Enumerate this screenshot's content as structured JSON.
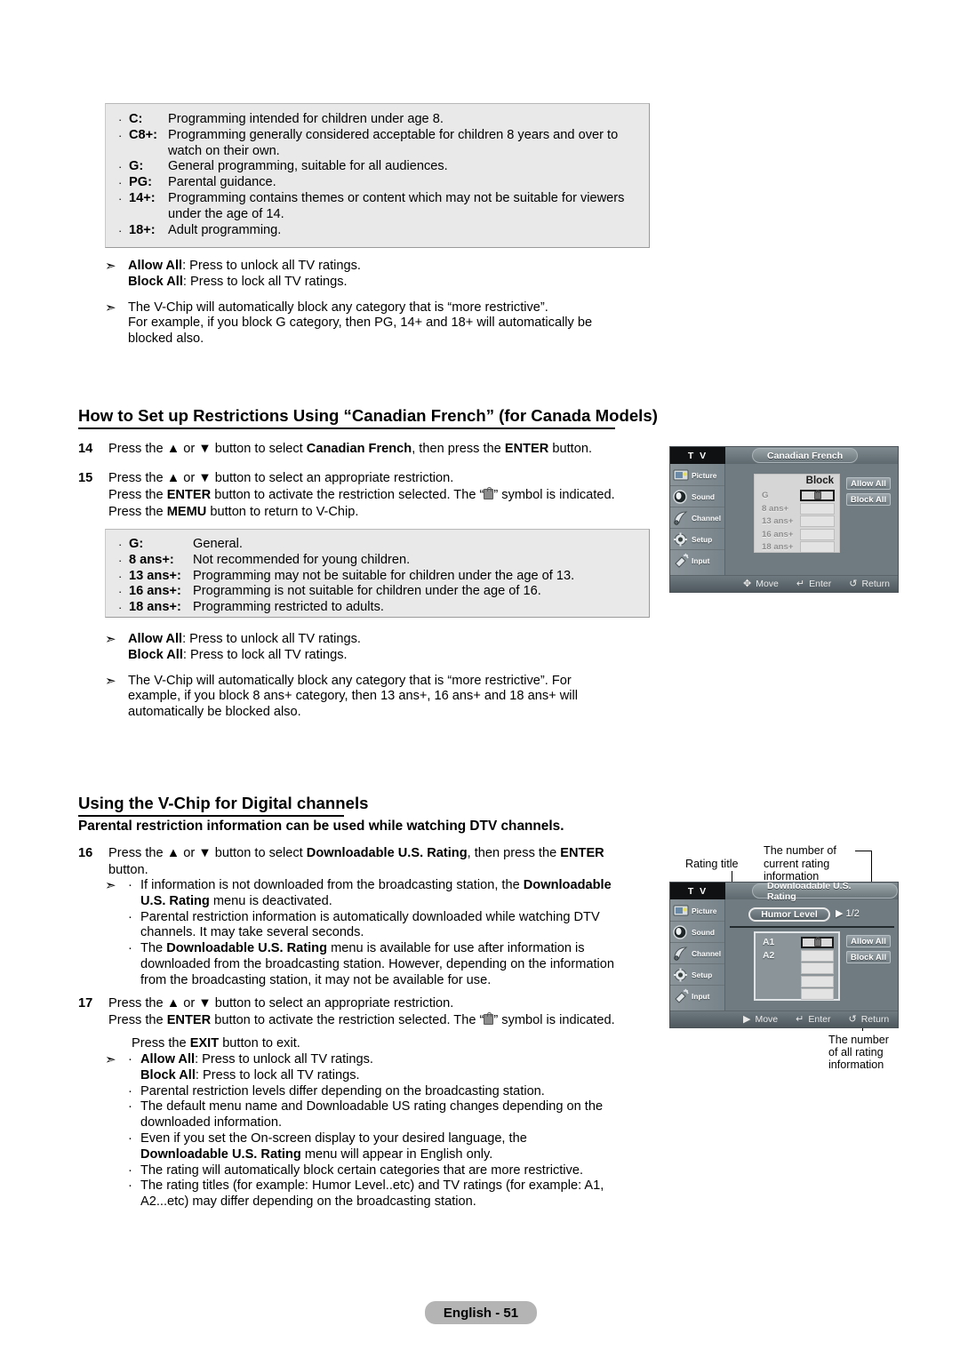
{
  "page": {
    "footer_label": "English - 51"
  },
  "tv_ratings_box": {
    "items": [
      {
        "key": "C:",
        "desc": "Programming intended for children under age 8.",
        "cont": ""
      },
      {
        "key": "C8+:",
        "desc": "Programming generally considered acceptable for children 8 years and over to",
        "cont": "watch on their own."
      },
      {
        "key": "G:",
        "desc": "General programming, suitable for all audiences.",
        "cont": ""
      },
      {
        "key": "PG:",
        "desc": "Parental guidance.",
        "cont": ""
      },
      {
        "key": "14+:",
        "desc": "Programming contains themes or content which may not be suitable for viewers",
        "cont": "under the age of 14."
      },
      {
        "key": "18+:",
        "desc": "Adult programming.",
        "cont": ""
      }
    ]
  },
  "notes_english": {
    "arrow": "➣",
    "n1_bold1": "Allow All",
    "n1_rest1": ": Press to unlock all TV ratings.",
    "n1_bold2": "Block All",
    "n1_rest2": ": Press to lock all TV ratings.",
    "n2_l1": "The V-Chip will automatically block any category that is “more restrictive”.",
    "n2_l2": "For example, if you block G category, then PG, 14+ and 18+ will automatically be",
    "n2_l3": "blocked also."
  },
  "section_cf": {
    "heading": "How to Set up Restrictions Using “Canadian French” (for Canada Models)",
    "step14": {
      "num": "14",
      "pre": "Press the ",
      "up": "▲",
      "mid": " or ",
      "down": "▼",
      "post": " button to select ",
      "bold1": "Canadian French",
      "post2": ", then press the ",
      "bold2": "ENTER",
      "post3": " button."
    },
    "step15": {
      "num": "15",
      "l1_pre": "Press the ",
      "l1_up": "▲",
      "l1_mid": " or ",
      "l1_down": "▼",
      "l1_post": " button to select an appropriate restriction.",
      "l2_pre": "Press the ",
      "l2_b": "ENTER",
      "l2_mid": " button to activate the restriction selected. The “",
      "l2_post": "” symbol is indicated.",
      "l3_pre": "Press the ",
      "l3_b": "MEMU",
      "l3_post": " button to return to V-Chip."
    }
  },
  "cf_ratings_box": {
    "items": [
      {
        "key": "G:",
        "desc": "General."
      },
      {
        "key": "8 ans+:",
        "desc": "Not recommended for young children."
      },
      {
        "key": "13 ans+:",
        "desc": "Programming may not be suitable for children under the age of 13."
      },
      {
        "key": "16 ans+:",
        "desc": "Programming is not suitable for children under the age of 16."
      },
      {
        "key": "18 ans+:",
        "desc": "Programming restricted to adults."
      }
    ]
  },
  "notes_cf": {
    "arrow": "➣",
    "n1_bold1": "Allow All",
    "n1_rest1": ": Press to unlock all TV ratings.",
    "n1_bold2": "Block All",
    "n1_rest2": ": Press to lock all TV ratings.",
    "n2_l1": "The V-Chip will automatically block any category that is “more restrictive”. For",
    "n2_l2": "example, if you block 8 ans+ category, then 13 ans+, 16 ans+ and 18 ans+ will",
    "n2_l3": "automatically be blocked also."
  },
  "section_dtv": {
    "heading": "Using the V-Chip for Digital channels",
    "subheading": "Parental restriction information can be used while watching DTV channels.",
    "step16": {
      "num": "16",
      "pre": "Press the ",
      "up": "▲",
      "mid": " or ",
      "down": "▼",
      "post": " button to select ",
      "bold1": "Downloadable U.S. Rating",
      "post2": ", then press the ",
      "bold2": "ENTER",
      "l2": "button."
    },
    "step16_notes": [
      {
        "bullet": "·",
        "lines": [
          {
            "t": "If information is not downloaded from the broadcasting station, the ",
            "b": "Downloadable"
          },
          {
            "b": "U.S. Rating",
            "t": " menu is deactivated."
          }
        ]
      },
      {
        "bullet": "·",
        "lines": [
          {
            "t": "Parental restriction information is automatically downloaded while watching DTV"
          },
          {
            "t": "channels. It may take several seconds."
          }
        ]
      },
      {
        "bullet": "·",
        "lines": [
          {
            "t": "The ",
            "b": "Downloadable U.S. Rating",
            "t2": " menu is available for use after information is"
          },
          {
            "t": "downloaded from the broadcasting station. However, depending on the information"
          },
          {
            "t": "from the broadcasting station, it may not be available for use."
          }
        ]
      }
    ],
    "step17": {
      "num": "17",
      "l1_pre": "Press the ",
      "l1_up": "▲",
      "l1_mid": " or ",
      "l1_down": "▼",
      "l1_post": " button to select an appropriate restriction.",
      "l2_pre": "Press the ",
      "l2_b": "ENTER",
      "l2_mid": " button to activate the restriction selected. The “",
      "l2_post": "” symbol is indicated.",
      "l3_pre": "Press the ",
      "l3_b": "EXIT",
      "l3_post": " button to exit."
    },
    "step17_notes": {
      "arrow": "➣",
      "bullet": "·",
      "b1_bold": "Allow All",
      "b1_rest": ": Press to unlock all TV ratings.",
      "b1_bold2": "Block All",
      "b1_rest2": ": Press to lock all TV ratings.",
      "b2": "Parental restriction levels differ depending on the broadcasting station.",
      "b3_l1": "The default menu name and Downloadable US rating changes depending on the",
      "b3_l2": "downloaded information.",
      "b4_l1": "Even if you set the On-screen display to your desired language, the",
      "b4_l2_bold": "Downloadable U.S. Rating",
      "b4_l2_rest": " menu will appear in English only.",
      "b5": "The rating will automatically block certain categories that are more restrictive.",
      "b6_l1": "The rating titles (for example: Humor Level..etc) and TV ratings (for example: A1,",
      "b6_l2": "A2...etc) may differ depending on the broadcasting station."
    }
  },
  "tv_menu_cf": {
    "tv_label": "T V",
    "title": "Canadian French",
    "sidebar": [
      {
        "label": "Picture",
        "icon": "picture-icon"
      },
      {
        "label": "Sound",
        "icon": "sound-icon"
      },
      {
        "label": "Channel",
        "icon": "channel-icon"
      },
      {
        "label": "Setup",
        "icon": "setup-icon"
      },
      {
        "label": "Input",
        "icon": "input-icon"
      }
    ],
    "block_header": "Block",
    "rows": [
      {
        "name": "G",
        "locked": true
      },
      {
        "name": "8  ans+",
        "locked": false
      },
      {
        "name": "13 ans+",
        "locked": false
      },
      {
        "name": "16 ans+",
        "locked": false
      },
      {
        "name": "18 ans+",
        "locked": false
      }
    ],
    "allow_all": "Allow All",
    "block_all": "Block All",
    "footer": [
      {
        "icon": "dpad-icon",
        "glyph": "✥",
        "label": "Move"
      },
      {
        "icon": "enter-icon",
        "glyph": "↵",
        "label": "Enter"
      },
      {
        "icon": "return-icon",
        "glyph": "↺",
        "label": "Return"
      }
    ]
  },
  "tv_menu_dtv": {
    "tv_label": "T V",
    "title": "Downloadable U.S. Rating",
    "rating_title": "Humor Level",
    "page_arrow": "▶",
    "page_count": "1/2",
    "sidebar": [
      {
        "label": "Picture",
        "icon": "picture-icon"
      },
      {
        "label": "Sound",
        "icon": "sound-icon"
      },
      {
        "label": "Channel",
        "icon": "channel-icon"
      },
      {
        "label": "Setup",
        "icon": "setup-icon"
      },
      {
        "label": "Input",
        "icon": "input-icon"
      }
    ],
    "rows": [
      {
        "name": "A1",
        "locked": true
      },
      {
        "name": "A2",
        "locked": false
      },
      {
        "name": "",
        "locked": false
      },
      {
        "name": "",
        "locked": false
      },
      {
        "name": "",
        "locked": false
      }
    ],
    "allow_all": "Allow All",
    "block_all": "Block All",
    "footer": [
      {
        "icon": "move-icon",
        "glyph": "▶",
        "label": "Move"
      },
      {
        "icon": "enter-icon",
        "glyph": "↵",
        "label": "Enter"
      },
      {
        "icon": "return-icon",
        "glyph": "↺",
        "label": "Return"
      }
    ],
    "callouts": {
      "rating_title": "Rating title",
      "current_l1": "The number of",
      "current_l2": "current rating",
      "current_l3": "information",
      "all_l1": "The number",
      "all_l2": "of all rating",
      "all_l3": "information"
    }
  }
}
